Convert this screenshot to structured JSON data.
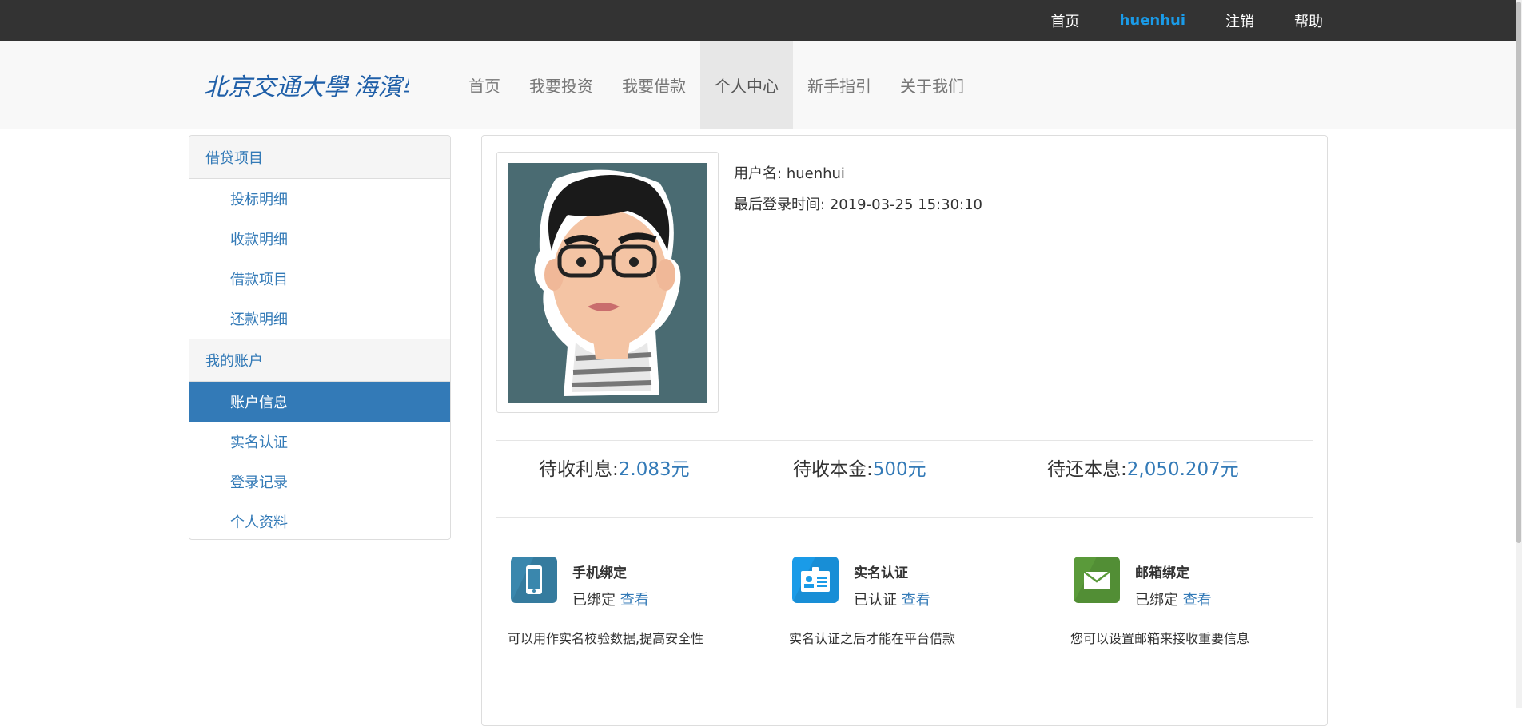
{
  "topbar": {
    "links": [
      "首页",
      "huenhui",
      "注销",
      "帮助"
    ]
  },
  "nav": {
    "logo": "北京交通大學 海濱學院",
    "items": [
      "首页",
      "我要投资",
      "我要借款",
      "个人中心",
      "新手指引",
      "关于我们"
    ],
    "active": "个人中心"
  },
  "sidebar": {
    "sections": [
      {
        "heading": "借贷项目",
        "items": [
          "投标明细",
          "收款明细",
          "借款项目",
          "还款明细"
        ]
      },
      {
        "heading": "我的账户",
        "items": [
          "账户信息",
          "实名认证",
          "登录记录",
          "个人资料"
        ]
      }
    ],
    "active": "账户信息"
  },
  "profile": {
    "username_label": "用户名:",
    "username": "huenhui",
    "last_login_label": "最后登录时间:",
    "last_login": "2019-03-25 15:30:10"
  },
  "stats": [
    {
      "label": "待收利息:",
      "value": "2.083元"
    },
    {
      "label": "待收本金:",
      "value": "500元"
    },
    {
      "label": "待还本息:",
      "value": "2,050.207元"
    }
  ],
  "features": [
    {
      "title": "手机绑定",
      "status": "已绑定",
      "link": "查看",
      "desc": "可以用作实名校验数据,提高安全性",
      "icon": "phone-icon",
      "color": "#3a87ad"
    },
    {
      "title": "实名认证",
      "status": "已认证",
      "link": "查看",
      "desc": "实名认证之后才能在平台借款",
      "icon": "id-card-icon",
      "color": "#1a9be8"
    },
    {
      "title": "邮箱绑定",
      "status": "已绑定",
      "link": "查看",
      "desc": "您可以设置邮箱来接收重要信息",
      "icon": "mail-icon",
      "color": "#5a9a3a"
    }
  ],
  "colors": {
    "topbar": "#333333",
    "user": "#1a9be8",
    "link": "#337ab7",
    "active_nav_bg": "#e7e7e7"
  }
}
